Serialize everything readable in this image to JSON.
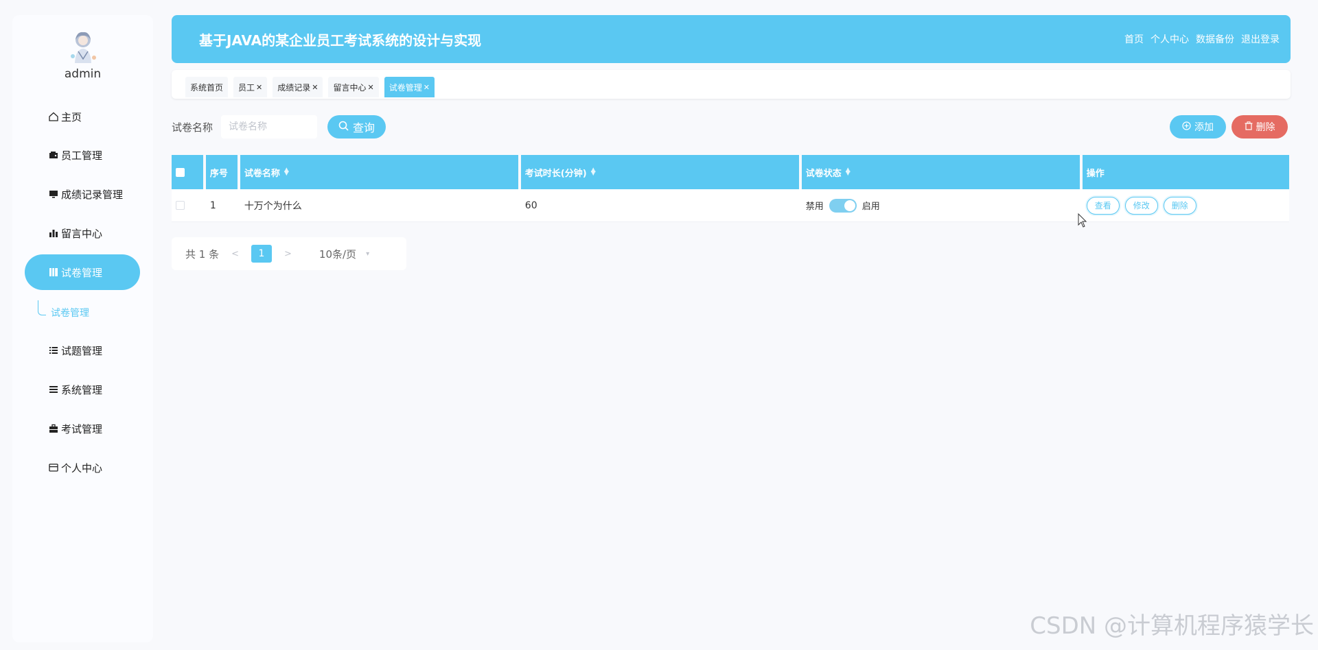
{
  "user": {
    "name": "admin"
  },
  "sidebar": {
    "items": [
      {
        "label": "主页",
        "icon": "home-icon"
      },
      {
        "label": "员工管理",
        "icon": "wallet-icon"
      },
      {
        "label": "成绩记录管理",
        "icon": "monitor-icon"
      },
      {
        "label": "留言中心",
        "icon": "bar-chart-icon"
      },
      {
        "label": "试卷管理",
        "icon": "book-icon",
        "active": true
      },
      {
        "label": "试题管理",
        "icon": "list-icon"
      },
      {
        "label": "系统管理",
        "icon": "menu-lines-icon"
      },
      {
        "label": "考试管理",
        "icon": "briefcase-icon"
      },
      {
        "label": "个人中心",
        "icon": "card-icon"
      }
    ],
    "submenu": {
      "label": "试卷管理"
    }
  },
  "header": {
    "title": "基于JAVA的某企业员工考试系统的设计与实现",
    "nav": [
      "首页",
      "个人中心",
      "数据备份",
      "退出登录"
    ]
  },
  "tabs": [
    {
      "label": "系统首页",
      "closable": false
    },
    {
      "label": "员工",
      "closable": true
    },
    {
      "label": "成绩记录",
      "closable": true
    },
    {
      "label": "留言中心",
      "closable": true
    },
    {
      "label": "试卷管理",
      "closable": true,
      "active": true
    }
  ],
  "search": {
    "label": "试卷名称",
    "placeholder": "试卷名称",
    "value": "",
    "query_button": "查询"
  },
  "toolbar": {
    "add_label": "添加",
    "delete_label": "删除"
  },
  "table": {
    "columns": [
      "序号",
      "试卷名称",
      "考试时长(分钟)",
      "试卷状态",
      "操作"
    ],
    "rows": [
      {
        "index": "1",
        "name": "十万个为什么",
        "duration": "60",
        "status_off": "禁用",
        "status_on": "启用",
        "enabled": true,
        "actions": [
          "查看",
          "修改",
          "删除"
        ]
      }
    ]
  },
  "pagination": {
    "total_text": "共 1 条",
    "current_page": "1",
    "page_size": "10条/页"
  },
  "watermark": "CSDN @计算机程序猿学长",
  "colors": {
    "accent": "#5ac8f2",
    "danger": "#e56b62",
    "background": "#f8f9fc"
  }
}
